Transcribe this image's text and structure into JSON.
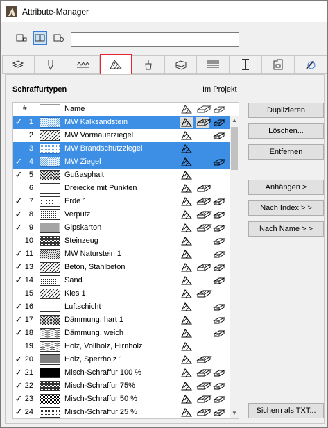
{
  "window": {
    "title": "Attribute-Manager"
  },
  "view_buttons": [
    {
      "name": "view-mode-1-button",
      "active": false
    },
    {
      "name": "view-mode-2-button",
      "active": true
    },
    {
      "name": "view-mode-3-button",
      "active": false
    }
  ],
  "search": {
    "value": ""
  },
  "tabs": [
    {
      "name": "tab-layers",
      "icon": "layers-icon"
    },
    {
      "name": "tab-pens",
      "icon": "pen-icon"
    },
    {
      "name": "tab-line-types",
      "icon": "line-type-icon"
    },
    {
      "name": "tab-fills",
      "icon": "fill-icon",
      "active": true
    },
    {
      "name": "tab-surfaces",
      "icon": "paint-bucket-icon"
    },
    {
      "name": "tab-composites",
      "icon": "composite-icon"
    },
    {
      "name": "tab-building-materials",
      "icon": "building-material-icon"
    },
    {
      "name": "tab-profiles",
      "icon": "profile-icon"
    },
    {
      "name": "tab-zones",
      "icon": "zone-icon"
    },
    {
      "name": "tab-markups",
      "icon": "markup-icon"
    }
  ],
  "section": {
    "title": "Schraffurtypen",
    "in_project": "Im Projekt"
  },
  "list": {
    "header_hash": "#",
    "header_name": "Name",
    "rows": [
      {
        "num": "1",
        "name": "MW Kalksandstein",
        "checked": true,
        "selected": true,
        "pattern": "diag-fine",
        "icons": [
          1,
          1,
          1
        ]
      },
      {
        "num": "2",
        "name": "MW Vormauerziegel",
        "checked": false,
        "selected": false,
        "pattern": "diag-wide",
        "icons": [
          1,
          0,
          1
        ]
      },
      {
        "num": "3",
        "name": "MW Brandschutzziegel",
        "checked": false,
        "selected": true,
        "pattern": "dots-fine",
        "icons": [
          1,
          0,
          0
        ]
      },
      {
        "num": "4",
        "name": "MW Ziegel",
        "checked": true,
        "selected": true,
        "pattern": "diag-fine",
        "icons": [
          1,
          0,
          1
        ]
      },
      {
        "num": "5",
        "name": "Gußasphalt",
        "checked": true,
        "selected": false,
        "pattern": "cross",
        "icons": [
          1,
          0,
          0
        ]
      },
      {
        "num": "6",
        "name": "Dreiecke mit Punkten",
        "checked": false,
        "selected": false,
        "pattern": "dots",
        "icons": [
          1,
          1,
          0
        ]
      },
      {
        "num": "7",
        "name": "Erde 1",
        "checked": true,
        "selected": false,
        "pattern": "dots-sparse",
        "icons": [
          1,
          1,
          1
        ]
      },
      {
        "num": "8",
        "name": "Verputz",
        "checked": true,
        "selected": false,
        "pattern": "dots",
        "icons": [
          1,
          1,
          1
        ]
      },
      {
        "num": "9",
        "name": "Gipskarton",
        "checked": true,
        "selected": false,
        "pattern": "grid",
        "icons": [
          1,
          1,
          1
        ]
      },
      {
        "num": "10",
        "name": "Steinzeug",
        "checked": false,
        "selected": false,
        "pattern": "dense",
        "icons": [
          1,
          0,
          1
        ]
      },
      {
        "num": "11",
        "name": "MW Naturstein 1",
        "checked": true,
        "selected": false,
        "pattern": "diag-fine",
        "icons": [
          1,
          0,
          1
        ]
      },
      {
        "num": "13",
        "name": "Beton, Stahlbeton",
        "checked": true,
        "selected": false,
        "pattern": "diag-wide",
        "icons": [
          1,
          1,
          1
        ]
      },
      {
        "num": "14",
        "name": "Sand",
        "checked": true,
        "selected": false,
        "pattern": "dots",
        "icons": [
          1,
          0,
          1
        ]
      },
      {
        "num": "15",
        "name": "Kies 1",
        "checked": false,
        "selected": false,
        "pattern": "diag-wide",
        "icons": [
          1,
          1,
          0
        ]
      },
      {
        "num": "16",
        "name": "Luftschicht",
        "checked": true,
        "selected": false,
        "pattern": "empty",
        "icons": [
          1,
          0,
          1
        ]
      },
      {
        "num": "17",
        "name": "Dämmung, hart 1",
        "checked": true,
        "selected": false,
        "pattern": "cross",
        "icons": [
          1,
          0,
          1
        ]
      },
      {
        "num": "18",
        "name": "Dämmung, weich",
        "checked": true,
        "selected": false,
        "pattern": "wave",
        "icons": [
          1,
          0,
          1
        ]
      },
      {
        "num": "19",
        "name": "Holz, Vollholz, Hirnholz",
        "checked": false,
        "selected": false,
        "pattern": "wave",
        "icons": [
          1,
          0,
          0
        ]
      },
      {
        "num": "20",
        "name": "Holz, Sperrholz 1",
        "checked": true,
        "selected": false,
        "pattern": "hlines",
        "icons": [
          1,
          1,
          0
        ]
      },
      {
        "num": "21",
        "name": "Misch-Schraffur 100 %",
        "checked": true,
        "selected": false,
        "pattern": "solid",
        "icons": [
          1,
          1,
          1
        ]
      },
      {
        "num": "22",
        "name": "Misch-Schraffur 75%",
        "checked": true,
        "selected": false,
        "pattern": "dense",
        "icons": [
          1,
          1,
          1
        ]
      },
      {
        "num": "23",
        "name": "Misch-Schraffur 50 %",
        "checked": true,
        "selected": false,
        "pattern": "checker",
        "icons": [
          1,
          1,
          1
        ]
      },
      {
        "num": "24",
        "name": "Misch-Schraffur 25 %",
        "checked": true,
        "selected": false,
        "pattern": "dots-fine",
        "icons": [
          1,
          1,
          1
        ]
      }
    ]
  },
  "buttons": {
    "duplicate": "Duplizieren",
    "delete": "Löschen...",
    "remove": "Entfernen",
    "append": "Anhängen >",
    "by_index": "Nach Index > >",
    "by_name": "Nach Name > >",
    "save_txt": "Sichern als TXT..."
  },
  "colors": {
    "selection": "#3d8fe6",
    "active_tab_border": "#e8252e"
  }
}
